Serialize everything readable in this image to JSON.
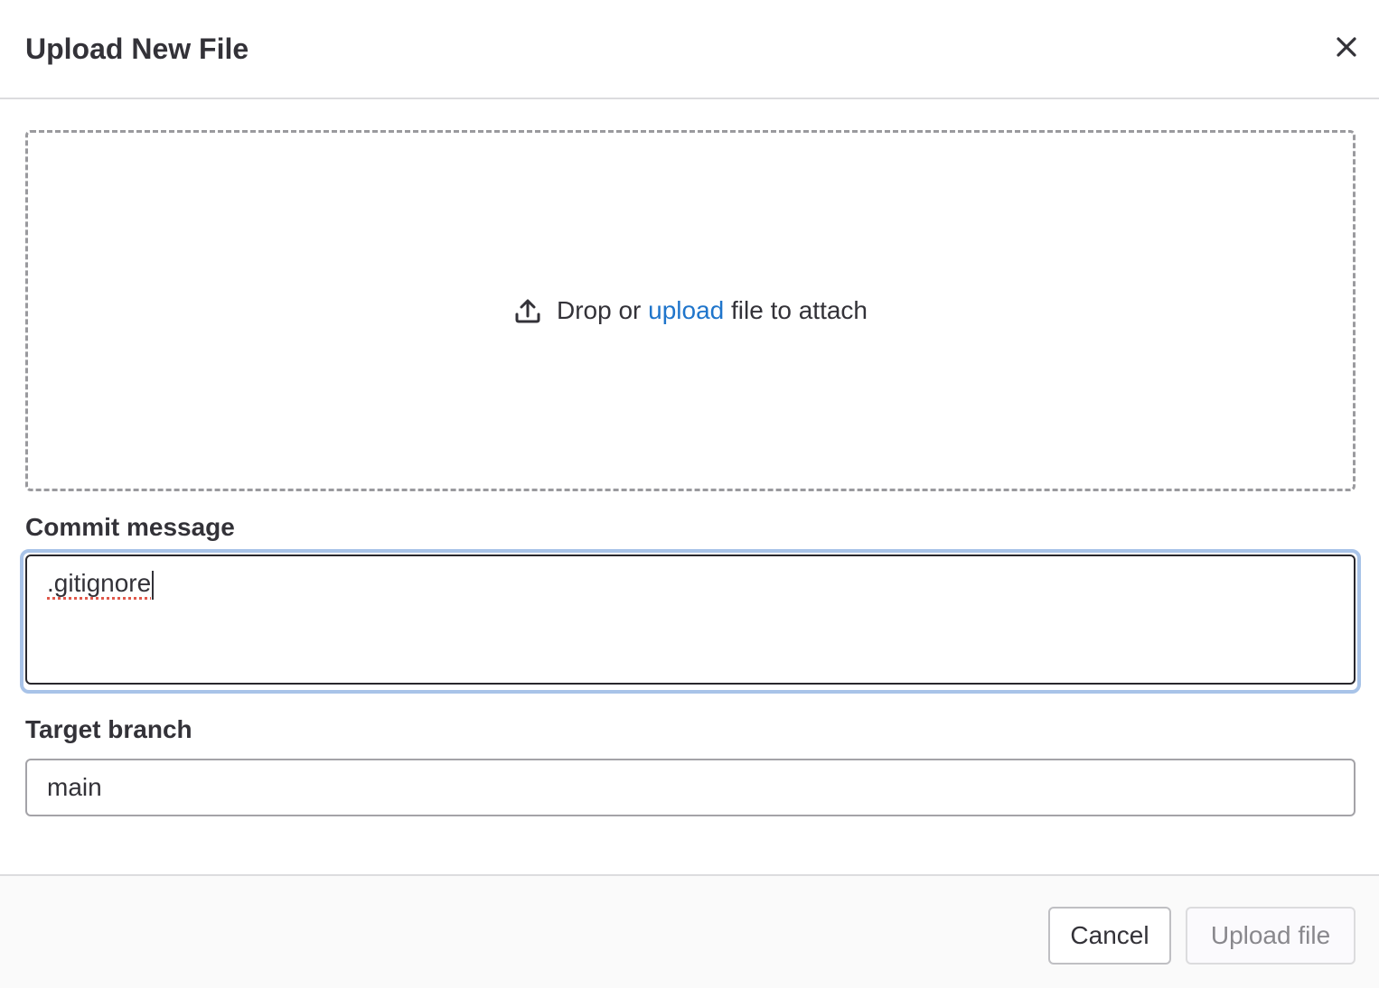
{
  "modal": {
    "title": "Upload New File"
  },
  "dropzone": {
    "text_before": "Drop or ",
    "link_text": "upload",
    "text_after": " file to attach",
    "link_color": "#1f75cb"
  },
  "commit": {
    "label": "Commit message",
    "value": ".gitignore"
  },
  "branch": {
    "label": "Target branch",
    "value": "main"
  },
  "footer": {
    "cancel_label": "Cancel",
    "upload_label": "Upload file",
    "upload_disabled": true
  },
  "icons": {
    "close": "close-icon",
    "upload": "upload-icon"
  }
}
